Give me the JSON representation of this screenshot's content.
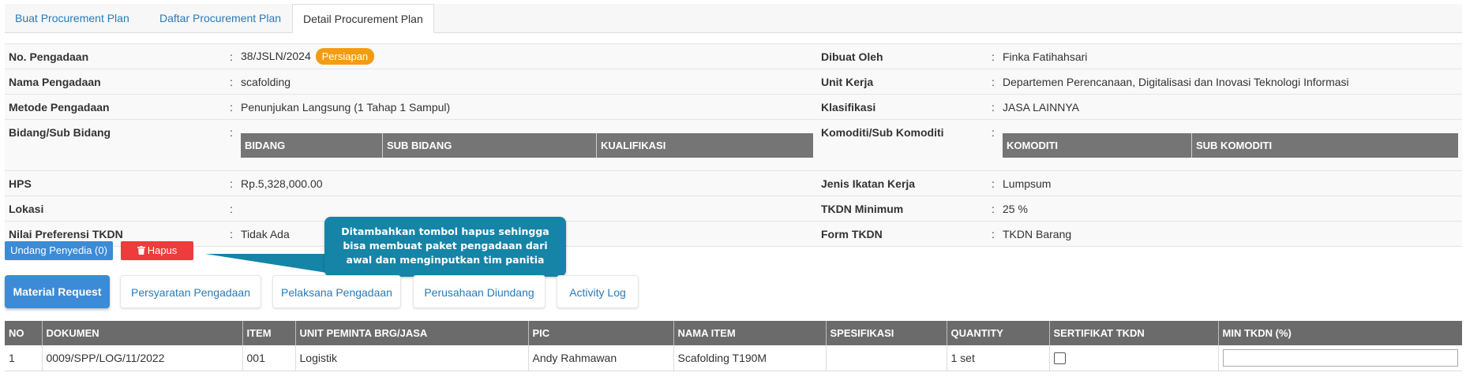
{
  "tabs": [
    {
      "label": "Buat Procurement Plan"
    },
    {
      "label": "Daftar Procurement Plan"
    },
    {
      "label": "Detail Procurement Plan"
    }
  ],
  "separator": ":",
  "detail": {
    "no_pengadaan": {
      "label": "No. Pengadaan",
      "value": "38/JSLN/2024",
      "status": "Persiapan"
    },
    "nama_pengadaan": {
      "label": "Nama Pengadaan",
      "value": "scafolding"
    },
    "metode_pengadaan": {
      "label": "Metode Pengadaan",
      "value": "Penunjukan Langsung (1 Tahap 1 Sampul)"
    },
    "bidang": {
      "label": "Bidang/Sub Bidang",
      "columns": [
        "BIDANG",
        "SUB BIDANG",
        "KUALIFIKASI"
      ]
    },
    "hps": {
      "label": "HPS",
      "value": "Rp.5,328,000.00"
    },
    "lokasi": {
      "label": "Lokasi",
      "value": ""
    },
    "nilai_preferensi": {
      "label": "Nilai Preferensi TKDN",
      "value": "Tidak Ada"
    },
    "dibuat_oleh": {
      "label": "Dibuat Oleh",
      "value": "Finka Fatihahsari"
    },
    "unit_kerja": {
      "label": "Unit Kerja",
      "value": "Departemen Perencanaan, Digitalisasi dan Inovasi Teknologi Informasi"
    },
    "klasifikasi": {
      "label": "Klasifikasi",
      "value": "JASA LAINNYA"
    },
    "komoditi": {
      "label": "Komoditi/Sub Komoditi",
      "columns": [
        "KOMODITI",
        "SUB KOMODITI"
      ]
    },
    "jenis_ikatan": {
      "label": "Jenis Ikatan Kerja",
      "value": "Lumpsum"
    },
    "tkdn_minimum": {
      "label": "TKDN Minimum",
      "value": "25 %"
    },
    "form_tkdn": {
      "label": "Form TKDN",
      "value": "TKDN Barang"
    }
  },
  "actions": {
    "undang_label": "Undang Penyedia (0)",
    "hapus_icon": "trash-icon",
    "hapus_label": "Hapus"
  },
  "callout": {
    "lines": [
      "Ditambahkan tombol hapus sehingga",
      "bisa membuat paket pengadaan dari",
      "awal dan menginputkan tim panitia"
    ]
  },
  "section_tabs": [
    {
      "label": "Material Request",
      "active": true
    },
    {
      "label": "Persyaratan Pengadaan",
      "active": false
    },
    {
      "label": "Pelaksana Pengadaan",
      "active": false
    },
    {
      "label": "Perusahaan Diundang",
      "active": false
    },
    {
      "label": "Activity Log",
      "active": false
    }
  ],
  "material_table": {
    "headers": [
      "NO",
      "DOKUMEN",
      "ITEM",
      "UNIT PEMINTA BRG/JASA",
      "PIC",
      "NAMA ITEM",
      "SPESIFIKASI",
      "QUANTITY",
      "SERTIFIKAT TKDN",
      "MIN TKDN (%)"
    ],
    "rows": [
      {
        "no": "1",
        "dokumen": "0009/SPP/LOG/11/2022",
        "item": "001",
        "unit": "Logistik",
        "pic": "Andy Rahmawan",
        "nama_item": "Scafolding T190M",
        "spesifikasi": "",
        "quantity": "1 set",
        "sertifikat_tkdn": false,
        "min_tkdn": ""
      }
    ]
  },
  "colors": {
    "link": "#2a7ab8",
    "primary": "#3b8bd6",
    "danger": "#ee3b3b",
    "warning": "#f39c12",
    "callout": "#1584a7",
    "table_header": "#6b6b6b"
  }
}
